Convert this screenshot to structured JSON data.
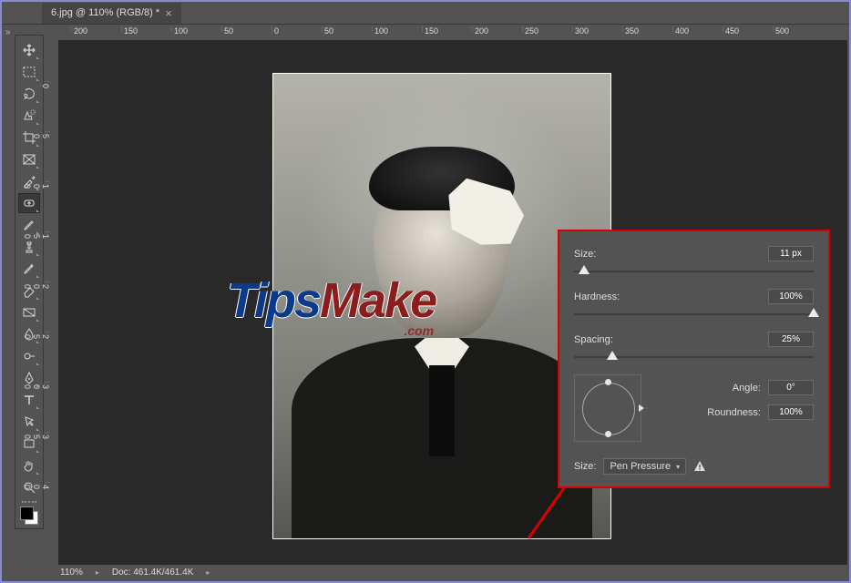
{
  "tab": {
    "title": "6.jpg @ 110% (RGB/8) *"
  },
  "rulers": {
    "top": [
      "200",
      "150",
      "100",
      "50",
      "0",
      "50",
      "100",
      "150",
      "200",
      "250",
      "300",
      "350",
      "400",
      "450",
      "500"
    ],
    "left": [
      "0",
      "50",
      "100",
      "150",
      "200",
      "250",
      "300",
      "350",
      "400"
    ]
  },
  "tools": {
    "move": "Move Tool",
    "marquee": "Rectangular Marquee",
    "lasso": "Lasso Tool",
    "quickselect": "Quick Selection",
    "crop": "Crop Tool",
    "frame": "Frame Tool",
    "eyedropper": "Eyedropper",
    "heal": "Spot Healing Brush",
    "brush": "Brush Tool",
    "stamp": "Clone Stamp",
    "history": "History Brush",
    "eraser": "Eraser",
    "gradient": "Gradient",
    "blur": "Blur",
    "dodge": "Dodge",
    "pen": "Pen Tool",
    "type": "Horizontal Type",
    "path": "Path Selection",
    "rect": "Rectangle",
    "hand": "Hand Tool",
    "zoom": "Zoom Tool"
  },
  "panel": {
    "size_label": "Size:",
    "size_value": "11 px",
    "hardness_label": "Hardness:",
    "hardness_value": "100%",
    "spacing_label": "Spacing:",
    "spacing_value": "25%",
    "angle_label": "Angle:",
    "angle_value": "0°",
    "roundness_label": "Roundness:",
    "roundness_value": "100%",
    "dynamics_size_label": "Size:",
    "dynamics_size_select": "Pen Pressure"
  },
  "statusbar": {
    "zoom": "110%",
    "doc": "Doc: 461.4K/461.4K"
  },
  "watermark": {
    "a": "Tips",
    "b": "Make",
    "c": ".com"
  }
}
